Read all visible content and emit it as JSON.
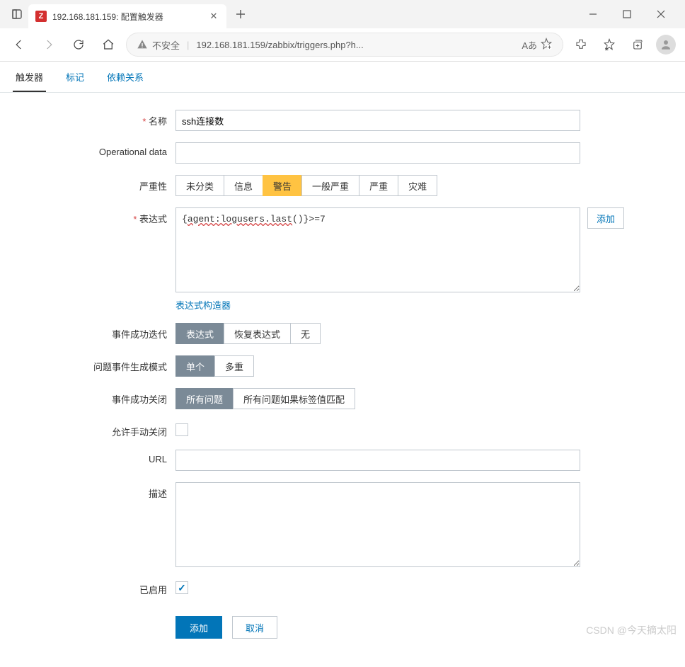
{
  "browser": {
    "tab_title": "192.168.181.159: 配置触发器",
    "insecure_label": "不安全",
    "url_display": "192.168.181.159/zabbix/triggers.php?h...",
    "read_aloud": "Aあ"
  },
  "tabs": {
    "trigger": "触发器",
    "tags": "标记",
    "dependencies": "依赖关系"
  },
  "labels": {
    "name": "名称",
    "operational_data": "Operational data",
    "severity": "严重性",
    "expression": "表达式",
    "expression_builder": "表达式构造器",
    "ok_event_gen": "事件成功迭代",
    "problem_event_mode": "问题事件生成模式",
    "ok_event_close": "事件成功关闭",
    "allow_manual_close": "允许手动关闭",
    "url": "URL",
    "description": "描述",
    "enabled": "已启用"
  },
  "fields": {
    "name": "ssh连接数",
    "operational_data": "",
    "expression": "{agent:logusers.last()}>=7",
    "url": "",
    "description": ""
  },
  "severity": [
    "未分类",
    "信息",
    "警告",
    "一般严重",
    "严重",
    "灾难"
  ],
  "severity_selected_index": 2,
  "ok_event_gen": [
    "表达式",
    "恢复表达式",
    "无"
  ],
  "problem_event_mode": [
    "单个",
    "多重"
  ],
  "ok_event_close": [
    "所有问题",
    "所有问题如果标签值匹配"
  ],
  "buttons": {
    "add_expr": "添加",
    "add": "添加",
    "cancel": "取消"
  },
  "watermark": "CSDN @今天摘太阳"
}
